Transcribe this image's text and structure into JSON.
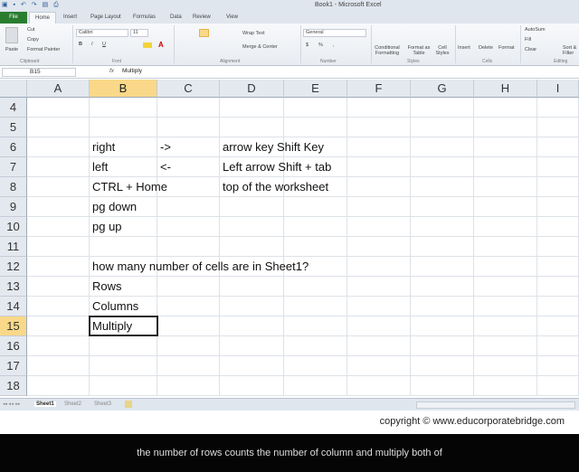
{
  "window": {
    "title": "Book1 - Microsoft Excel"
  },
  "ribbon_tabs": [
    "File",
    "Home",
    "Insert",
    "Page Layout",
    "Formulas",
    "Data",
    "Review",
    "View"
  ],
  "ribbon": {
    "clipboard": {
      "paste": "Paste",
      "cut": "Cut",
      "copy": "Copy",
      "format_painter": "Format Painter",
      "label": "Clipboard"
    },
    "font": {
      "name": "Calibri",
      "size": "11",
      "bold": "B",
      "italic": "I",
      "underline": "U",
      "label": "Font"
    },
    "alignment": {
      "wrap": "Wrap Text",
      "merge": "Merge & Center",
      "label": "Alignment"
    },
    "number": {
      "format": "General",
      "currency": "$",
      "percent": "%",
      "comma": ",",
      "label": "Number"
    },
    "styles": {
      "conditional": "Conditional Formatting",
      "format_table": "Format as Table",
      "cell_styles": "Cell Styles",
      "label": "Styles"
    },
    "cells": {
      "insert": "Insert",
      "delete": "Delete",
      "format": "Format",
      "label": "Cells"
    },
    "editing": {
      "autosum": "AutoSum",
      "fill": "Fill",
      "clear": "Clear",
      "sort": "Sort & Filter",
      "label": "Editing"
    }
  },
  "formula_bar": {
    "name_box": "B15",
    "fx": "fx",
    "value": "Multiply"
  },
  "columns": [
    "A",
    "B",
    "C",
    "D",
    "E",
    "F",
    "G",
    "H",
    "I"
  ],
  "rows": [
    "4",
    "5",
    "6",
    "7",
    "8",
    "9",
    "10",
    "11",
    "12",
    "13",
    "14",
    "15",
    "16",
    "17",
    "18"
  ],
  "cells": [
    {
      "row": "6",
      "col": "B",
      "text": "right"
    },
    {
      "row": "6",
      "col": "C",
      "text": "->"
    },
    {
      "row": "6",
      "col": "D",
      "text": "arrow key  Shift Key"
    },
    {
      "row": "7",
      "col": "B",
      "text": "left"
    },
    {
      "row": "7",
      "col": "C",
      "text": "<-"
    },
    {
      "row": "7",
      "col": "D",
      "text": "Left arrow Shift + tab"
    },
    {
      "row": "8",
      "col": "B",
      "text": "CTRL + Home"
    },
    {
      "row": "8",
      "col": "D",
      "text": "top of the worksheet"
    },
    {
      "row": "9",
      "col": "B",
      "text": "pg down"
    },
    {
      "row": "10",
      "col": "B",
      "text": "pg up"
    },
    {
      "row": "12",
      "col": "B",
      "text": "how many number of cells are in Sheet1?"
    },
    {
      "row": "13",
      "col": "B",
      "text": "Rows"
    },
    {
      "row": "14",
      "col": "B",
      "text": "Columns"
    },
    {
      "row": "15",
      "col": "B",
      "text": "Multiply"
    }
  ],
  "active_cell": "B15",
  "sheets": [
    "Sheet1",
    "Sheet2",
    "Sheet3"
  ],
  "copyright": "copyright © www.educorporatebridge.com",
  "subtitle": "the number of rows counts the number of column and multiply both of"
}
